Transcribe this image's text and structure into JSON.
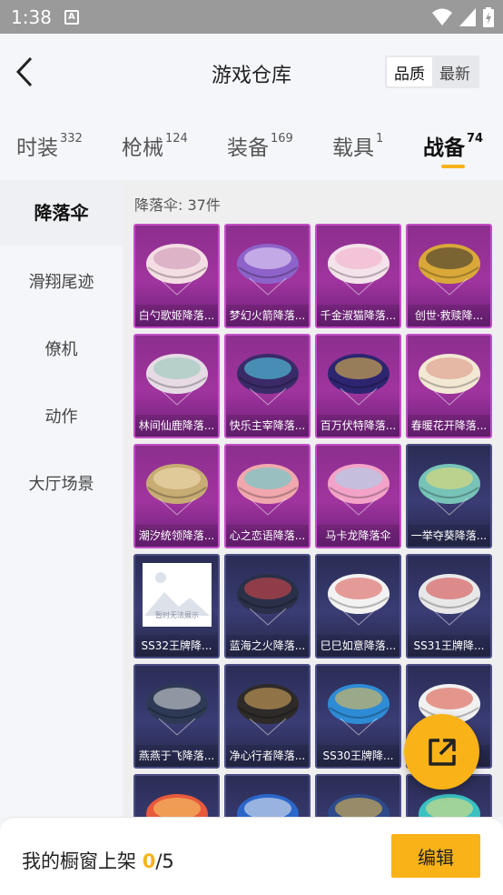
{
  "status_bar": {
    "time": "1:38",
    "sim_label": "A"
  },
  "header": {
    "title": "游戏仓库",
    "sort_quality": "品质",
    "sort_latest": "最新"
  },
  "tabs": [
    {
      "label": "时装",
      "count": "332"
    },
    {
      "label": "枪械",
      "count": "124"
    },
    {
      "label": "装备",
      "count": "169"
    },
    {
      "label": "载具",
      "count": "1"
    },
    {
      "label": "战备",
      "count": "74"
    }
  ],
  "sidebar": [
    {
      "label": "降落伞"
    },
    {
      "label": "滑翔尾迹"
    },
    {
      "label": "僚机"
    },
    {
      "label": "动作"
    },
    {
      "label": "大厅场景"
    }
  ],
  "content": {
    "count_label": "降落伞: 37件",
    "items": [
      {
        "name": "白勺歌姬降落...",
        "rarity": "purple",
        "color": "#f4dde3",
        "accent": "#c88fb0"
      },
      {
        "name": "梦幻火箭降落...",
        "rarity": "purple",
        "color": "#8d63c9",
        "accent": "#f3e3ff"
      },
      {
        "name": "千金淑猫降落...",
        "rarity": "purple",
        "color": "#f4e3ea",
        "accent": "#f3a9c7"
      },
      {
        "name": "创世·救赎降...",
        "rarity": "purple",
        "color": "#d9a839",
        "accent": "#2b2b2b"
      },
      {
        "name": "林间仙鹿降落...",
        "rarity": "purple",
        "color": "#e6dbe5",
        "accent": "#8fc7b4"
      },
      {
        "name": "快乐主宰降落...",
        "rarity": "purple",
        "color": "#3a2b68",
        "accent": "#53e0f2"
      },
      {
        "name": "百万伏特降落...",
        "rarity": "purple",
        "color": "#2d2570",
        "accent": "#f1c64a"
      },
      {
        "name": "春暖花开降落...",
        "rarity": "purple",
        "color": "#f2e8d4",
        "accent": "#d88f7c"
      },
      {
        "name": "潮汐统领降落...",
        "rarity": "purple",
        "color": "#c7ac73",
        "accent": "#f5e4b8"
      },
      {
        "name": "心之恋语降落...",
        "rarity": "purple",
        "color": "#f0a7ad",
        "accent": "#53d4cf"
      },
      {
        "name": "马卡龙降落伞",
        "rarity": "purple",
        "color": "#f3a3c7",
        "accent": "#9fd7ef"
      },
      {
        "name": "一举夺葵降落...",
        "rarity": "navy",
        "color": "#77c3b8",
        "accent": "#f3de6a"
      },
      {
        "name": "SS32王牌降...",
        "rarity": "navy",
        "color": "#ffffff",
        "accent": "#cfd5e0",
        "placeholder_text": "暂时无法展示"
      },
      {
        "name": "蓝海之火降落...",
        "rarity": "navy",
        "color": "#2a3048",
        "accent": "#e24a4a"
      },
      {
        "name": "巳巳如意降落...",
        "rarity": "navy",
        "color": "#f2f2f2",
        "accent": "#d9534f"
      },
      {
        "name": "SS31王牌降...",
        "rarity": "navy",
        "color": "#e8e8e8",
        "accent": "#d13c3c"
      },
      {
        "name": "燕燕于飞降落...",
        "rarity": "navy",
        "color": "#2e3a55",
        "accent": "#e2e2e2"
      },
      {
        "name": "净心行者降落...",
        "rarity": "navy",
        "color": "#2d2a28",
        "accent": "#e1b062"
      },
      {
        "name": "SS30王牌降...",
        "rarity": "navy",
        "color": "#2e8bd6",
        "accent": "#f2c34a"
      },
      {
        "name": "",
        "rarity": "navy",
        "color": "#f1f1f1",
        "accent": "#d94a3a"
      },
      {
        "name": "",
        "rarity": "navy",
        "color": "#e85a3c",
        "accent": "#f5d36a"
      },
      {
        "name": "",
        "rarity": "navy",
        "color": "#2b66c9",
        "accent": "#f2f2f2"
      },
      {
        "name": "",
        "rarity": "navy",
        "color": "#2d4a8a",
        "accent": "#f1c14f"
      },
      {
        "name": "",
        "rarity": "navy",
        "color": "#3ac1c2",
        "accent": "#f2e27a"
      }
    ]
  },
  "bottom": {
    "shelf_label": "我的橱窗上架 ",
    "shelf_current": "0",
    "shelf_total": "/5",
    "edit_label": "编辑"
  },
  "colors": {
    "accent": "#f9b318",
    "purple_card": "#a0349e",
    "navy_card": "#3a3c74"
  }
}
